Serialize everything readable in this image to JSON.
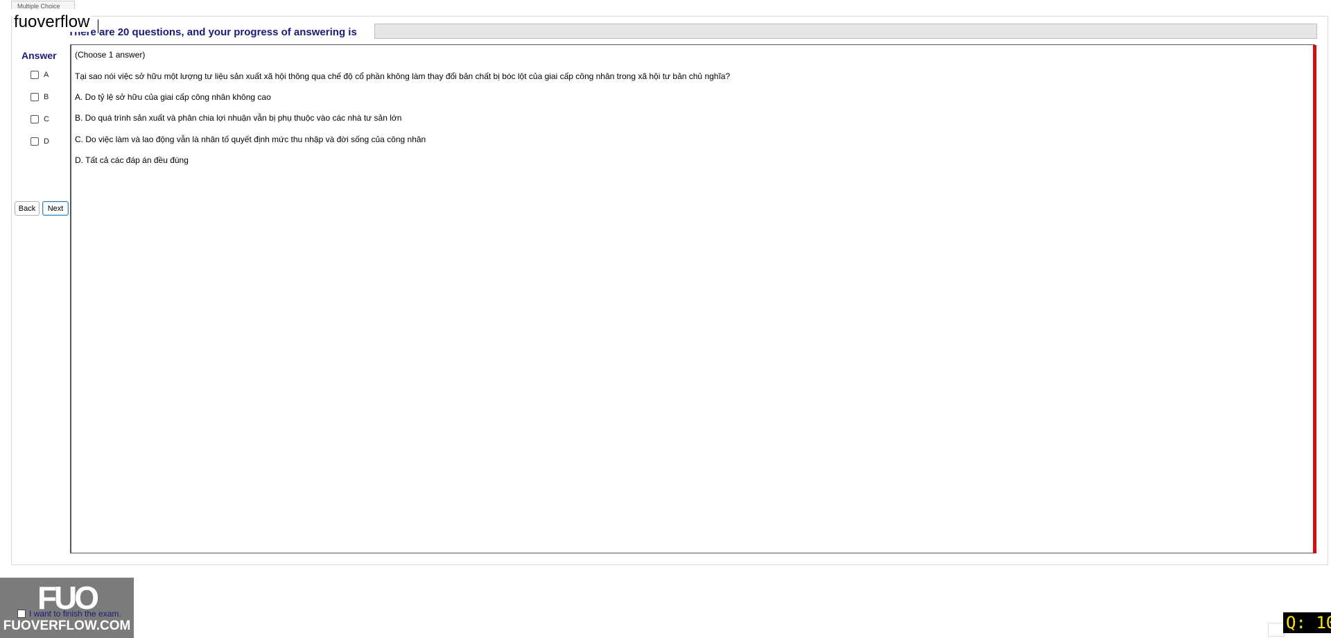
{
  "tab": {
    "label": "Multiple Choice"
  },
  "watermark": {
    "text": "fuoverflow"
  },
  "progress": {
    "label": "There are 20 questions, and your progress of answering is",
    "value": 0
  },
  "answer_panel": {
    "title": "Answer",
    "options": [
      "A",
      "B",
      "C",
      "D"
    ]
  },
  "nav": {
    "back_label": "Back",
    "next_label": "Next"
  },
  "question": {
    "instruction": "(Choose 1 answer)",
    "text": "Tại sao nói việc sở hữu một lượng tư liệu sản xuất xã hội thông qua chế độ cổ phần không làm thay đổi bản chất bị bóc lột của giai cấp công nhân trong xã hội tư bản chủ nghĩa?",
    "choices": [
      "A.  Do tỷ lệ sở hữu của giai cấp công nhân không cao",
      "B.  Do quá trình sản xuất và phân chia lợi nhuận vẫn bị phụ thuộc vào các nhà tư sản lớn",
      "C.  Do việc làm và lao động vẫn là nhân tố quyết định mức thu nhập và đời sống của công nhân",
      "D.  Tất cả các đáp án đều đúng"
    ]
  },
  "finish": {
    "label": "I want to finish the exam."
  },
  "logo": {
    "mark": "FUO",
    "text": "FUOVERFLOW.COM"
  },
  "counter": {
    "text": "Q: 10"
  },
  "colors": {
    "accent_red": "#cc1111",
    "title_blue": "#1a1a7a",
    "counter_yellow": "#ffe600"
  }
}
